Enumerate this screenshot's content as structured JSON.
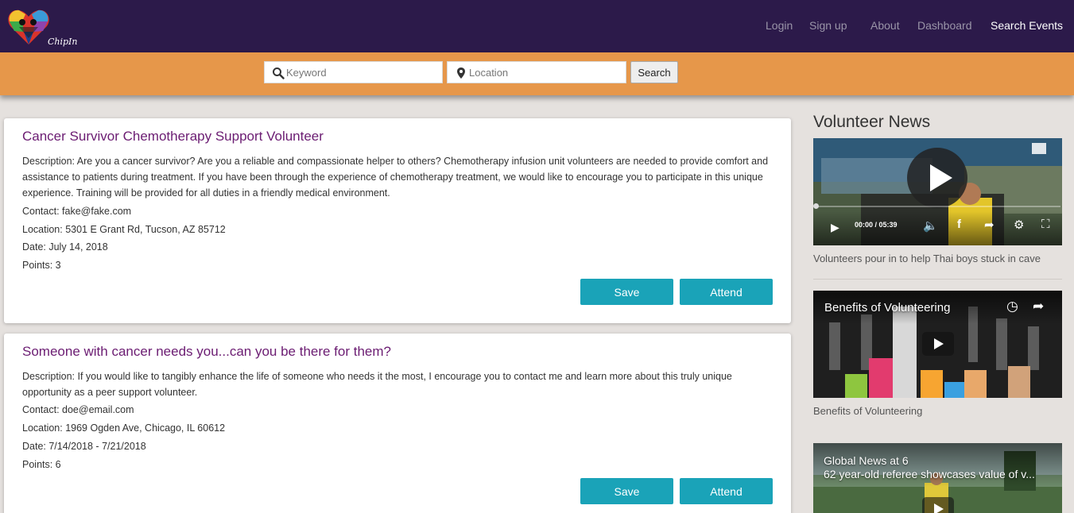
{
  "brand": {
    "name": "ChipIn"
  },
  "nav": {
    "login": "Login",
    "signup": "Sign up",
    "about": "About",
    "dashboard": "Dashboard",
    "search_events": "Search Events"
  },
  "search": {
    "keyword_placeholder": "Keyword",
    "keyword_value": "",
    "location_placeholder": "Location",
    "location_value": "",
    "button_label": "Search"
  },
  "events": [
    {
      "title": "Cancer Survivor Chemotherapy Support Volunteer",
      "description": "Description: Are you a cancer survivor? Are you a reliable and compassionate helper to others? Chemotherapy infusion unit volunteers are needed to provide comfort and assistance to patients during treatment. If you have been through the experience of chemotherapy treatment, we would like to encourage you to participate in this unique experience. Training will be provided for all duties in a friendly medical environment.",
      "contact": "Contact: fake@fake.com",
      "location": "Location: 5301 E Grant Rd, Tucson, AZ 85712",
      "date": "Date: July 14, 2018",
      "points": "Points: 3",
      "save_label": "Save",
      "attend_label": "Attend"
    },
    {
      "title": "Someone with cancer needs you...can you be there for them?",
      "description": "Description: If you would like to tangibly enhance the life of someone who needs it the most, I encourage you to contact me and learn more about this truly unique opportunity as a peer support volunteer.",
      "contact": "Contact: doe@email.com",
      "location": "Location: 1969 Ogden Ave, Chicago, IL 60612",
      "date": "Date: 7/14/2018 - 7/21/2018",
      "points": "Points: 6",
      "save_label": "Save",
      "attend_label": "Attend"
    }
  ],
  "sidebar": {
    "heading": "Volunteer News",
    "videos": [
      {
        "caption": "Volunteers pour in to help Thai boys stuck in cave",
        "time": "00:00 / 05:39",
        "progress": 0
      },
      {
        "overlay_title": "Benefits of Volunteering",
        "caption": "Benefits of Volunteering"
      },
      {
        "overlay_title": "Global News at 6",
        "overlay_subtitle": "62 year-old referee showcases value of v..."
      }
    ]
  },
  "colors": {
    "navbar": "#2c1a4a",
    "searchbar": "#e6974a",
    "accent_button": "#1aa3b8",
    "title": "#6b1c72"
  }
}
